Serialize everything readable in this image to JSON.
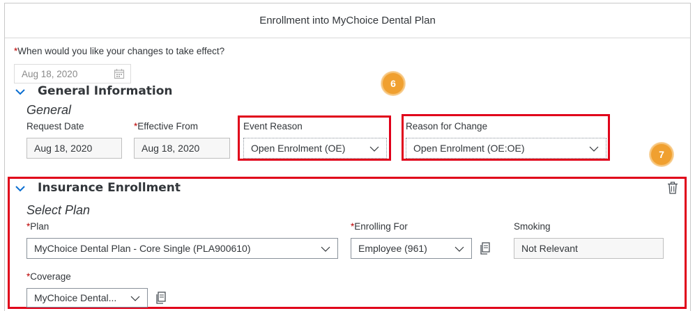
{
  "title": "Enrollment into MyChoice Dental Plan",
  "effective_question": {
    "required_marker": "*",
    "label": "When would you like your changes to take effect?",
    "value": "Aug 18, 2020"
  },
  "general_info": {
    "section_title": "General Information",
    "subtitle": "General",
    "request_date_label": "Request Date",
    "request_date_value": "Aug 18, 2020",
    "effective_from_required": "*",
    "effective_from_label": "Effective From",
    "effective_from_value": "Aug 18, 2020",
    "event_reason_label": "Event Reason",
    "event_reason_value": "Open Enrolment (OE)",
    "reason_change_label": "Reason for Change",
    "reason_change_value": "Open Enrolment (OE:OE)"
  },
  "callouts": {
    "six": "6",
    "seven": "7"
  },
  "insurance": {
    "section_title": "Insurance Enrollment",
    "subtitle": "Select Plan",
    "plan_required": "*",
    "plan_label": "Plan",
    "plan_value": "MyChoice Dental Plan - Core Single (PLA900610)",
    "enrolling_required": "*",
    "enrolling_label": "Enrolling For",
    "enrolling_value": "Employee (961)",
    "smoking_label": "Smoking",
    "smoking_value": "Not Relevant",
    "coverage_required": "*",
    "coverage_label": "Coverage",
    "coverage_value": "MyChoice Dental..."
  },
  "colors": {
    "highlight": "#e0001a",
    "badge": "#f0a030",
    "required": "#bb0000",
    "accent": "#0a6ed1"
  },
  "icons": {
    "collapse": "chevron-down-icon",
    "calendar": "calendar-icon",
    "delete": "trash-icon",
    "details": "copy-icon"
  }
}
